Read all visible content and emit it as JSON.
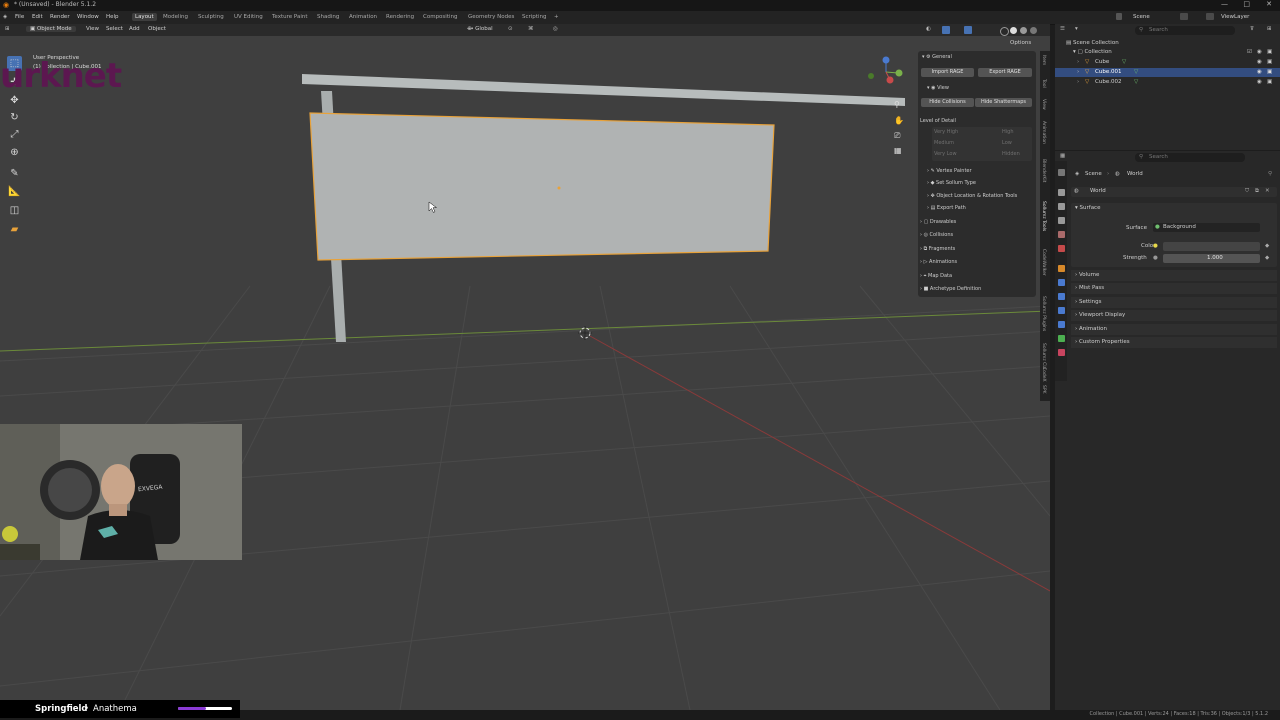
{
  "window": {
    "title": "* (Unsaved) - Blender 5.1.2"
  },
  "menu": [
    "File",
    "Edit",
    "Render",
    "Window",
    "Help"
  ],
  "workspaces": [
    {
      "label": "Layout",
      "active": true
    },
    {
      "label": "Modeling"
    },
    {
      "label": "Sculpting"
    },
    {
      "label": "UV Editing"
    },
    {
      "label": "Texture Paint"
    },
    {
      "label": "Shading"
    },
    {
      "label": "Animation"
    },
    {
      "label": "Rendering"
    },
    {
      "label": "Compositing"
    },
    {
      "label": "Geometry Nodes"
    },
    {
      "label": "Scripting"
    },
    {
      "label": "+"
    }
  ],
  "scene_field": "Scene",
  "viewlayer_field": "ViewLayer",
  "viewport_header": {
    "mode": "Object Mode",
    "menus": [
      "View",
      "Select",
      "Add",
      "Object"
    ],
    "orientation": "Global",
    "options": "Options"
  },
  "viewport": {
    "perspective_label": "User Perspective",
    "collection_label": "(1) Collection | Cube.001"
  },
  "npanel": {
    "general": "General",
    "import_btn": "Import RAGE",
    "export_btn": "Export RAGE",
    "view": "View",
    "hide_collisions": "Hide Collisions",
    "hide_shattermaps": "Hide Shattermaps",
    "lod_title": "Level of Detail",
    "lod": [
      "Very High",
      "High",
      "Medium",
      "Low",
      "Very Low",
      "Hidden"
    ],
    "tools": [
      "Vertex Painter",
      "Set Sollum Type",
      "Object Location & Rotation Tools",
      "Export Path"
    ],
    "sections": [
      "Drawables",
      "Collisions",
      "Fragments",
      "Animations",
      "Map Data",
      "Archetype Definition"
    ]
  },
  "ntabs": [
    "Item",
    "Tool",
    "View",
    "Animation",
    "BlenderKit",
    "Sollumz Tools",
    "CodeWalker",
    "Sollumz Plugins",
    "Sollumz CLI",
    "CodeX",
    "SPK"
  ],
  "outliner": {
    "root": "Scene Collection",
    "collection": "Collection",
    "items": [
      {
        "name": "Cube",
        "selected": false
      },
      {
        "name": "Cube.001",
        "selected": true
      },
      {
        "name": "Cube.002",
        "selected": false
      }
    ],
    "search_placeholder": "Search"
  },
  "properties": {
    "search_placeholder": "Search",
    "breadcrumb_scene": "Scene",
    "breadcrumb_world": "World",
    "world_name": "World",
    "surface_header": "Surface",
    "surface_label": "Surface",
    "surface_value": "Background",
    "color_label": "Color",
    "strength_label": "Strength",
    "strength_value": "1.000",
    "panels": [
      "Volume",
      "Mist Pass",
      "Settings",
      "Viewport Display",
      "Animation",
      "Custom Properties"
    ]
  },
  "statusbar": "Collection | Cube.001 | Verts:24 | Faces:18 | Tris:36 | Objects:1/3 | 5.1.2",
  "overlay": {
    "logo": "urknet",
    "song": "Springfield",
    "separator": "•",
    "artist": "Anathema",
    "progress": 0.52,
    "hoodie_text": "EXVEGA"
  }
}
